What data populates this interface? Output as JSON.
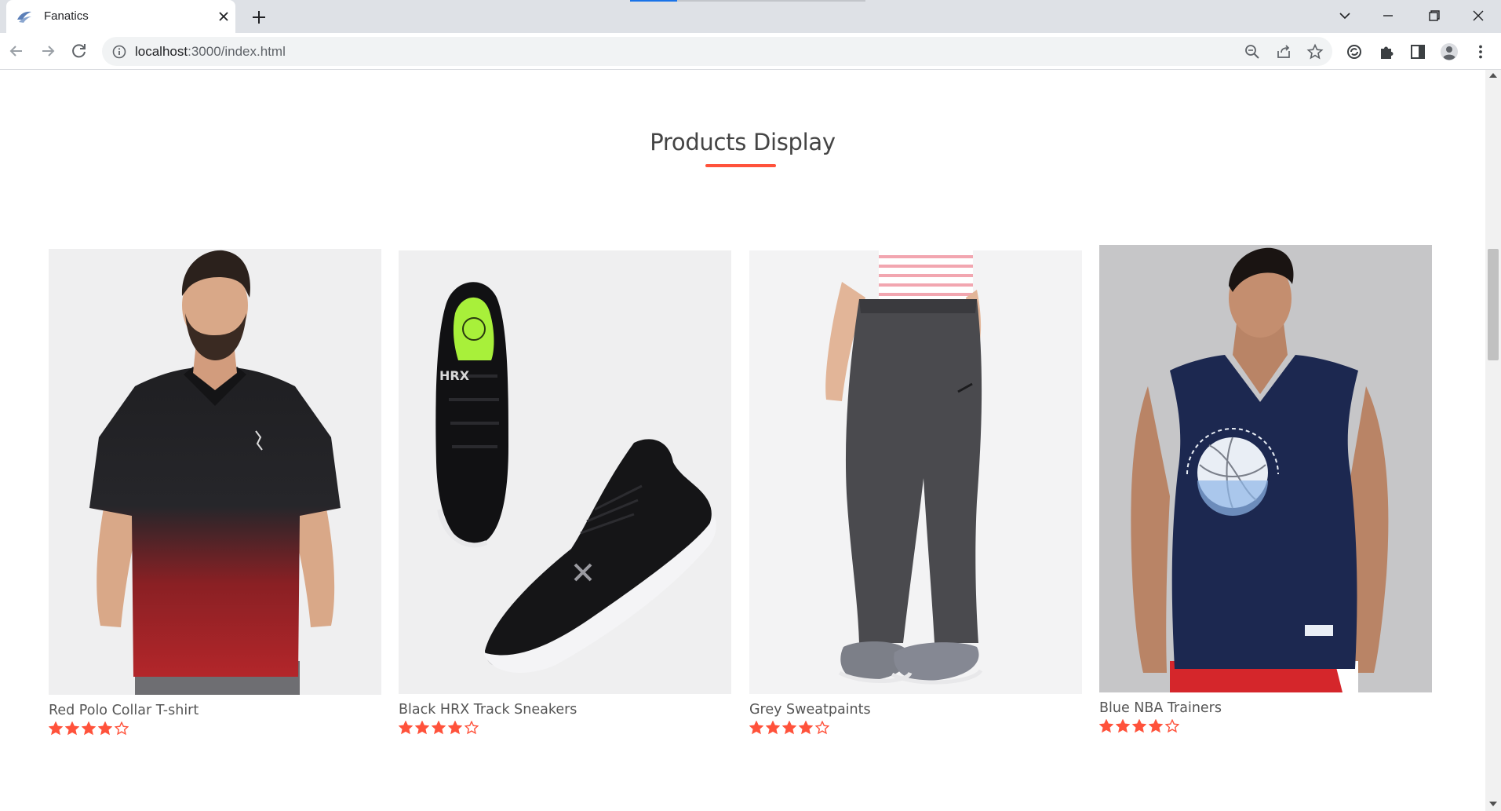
{
  "browser": {
    "tab_title": "Fanatics",
    "url_host": "localhost",
    "url_path": ":3000/index.html"
  },
  "icons": {
    "tab_favicon": "fanatics-logo-icon",
    "tab_close": "close-icon",
    "new_tab": "plus-icon",
    "back": "arrow-left-icon",
    "forward": "arrow-right-icon",
    "reload": "reload-icon",
    "site_info": "info-icon",
    "zoom": "zoom-out-icon",
    "share": "share-icon",
    "bookmark": "star-icon",
    "sync": "sync-icon",
    "extensions": "puzzle-icon",
    "side_panel": "side-panel-icon",
    "profile": "avatar-icon",
    "menu": "kebab-menu-icon"
  },
  "colors": {
    "accent": "#ff523b",
    "title_text": "#444444",
    "product_text": "#555555",
    "image_bg": "#efeff0"
  },
  "page": {
    "section_title": "Products Display"
  },
  "products": [
    {
      "name": "Red Polo Collar T-shirt",
      "rating": 4,
      "max_rating": 5
    },
    {
      "name": "Black HRX Track Sneakers",
      "rating": 4,
      "max_rating": 5
    },
    {
      "name": "Grey Sweatpaints",
      "rating": 4,
      "max_rating": 5
    },
    {
      "name": "Blue NBA Trainers",
      "rating": 4,
      "max_rating": 5
    }
  ]
}
